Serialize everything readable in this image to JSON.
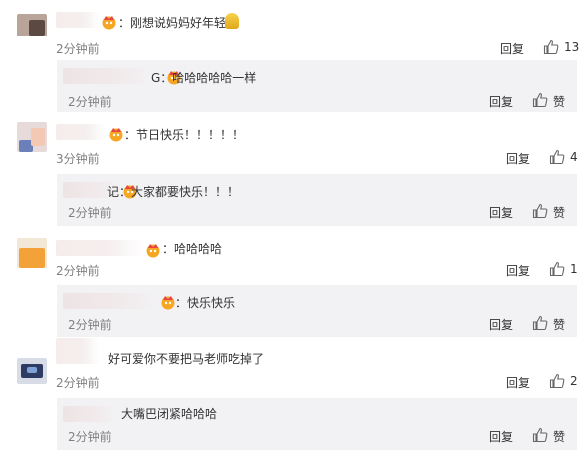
{
  "comments": [
    {
      "text": "：刚想说妈妈好年轻",
      "time": "2分钟前",
      "reply_label": "回复",
      "like_count": "13",
      "reply": {
        "text": "G：哈哈哈哈哈一样",
        "time": "2分钟前",
        "reply_label": "回复",
        "like_label": "赞"
      }
    },
    {
      "text": "：节日快乐！！！！！",
      "time": "3分钟前",
      "reply_label": "回复",
      "like_count": "4",
      "reply": {
        "text": "记：大家都要快乐！！！",
        "time": "2分钟前",
        "reply_label": "回复",
        "like_label": "赞"
      }
    },
    {
      "text": "：哈哈哈哈",
      "time": "2分钟前",
      "reply_label": "回复",
      "like_count": "1",
      "reply": {
        "text": "：快乐快乐",
        "time": "2分钟前",
        "reply_label": "回复",
        "like_label": "赞"
      }
    },
    {
      "text": "好可爱你不要把马老师吃掉了",
      "time": "2分钟前",
      "reply_label": "回复",
      "like_count": "2",
      "reply": {
        "text": "大嘴巴闭紧哈哈哈",
        "time": "2分钟前",
        "reply_label": "回复",
        "like_label": "赞"
      }
    }
  ],
  "colors": {
    "text": "#333333",
    "time": "#808080",
    "reply_bg": "#f2f2f5",
    "badge_gold": "#f5a623",
    "badge_red": "#e64545"
  },
  "icons": {
    "like": "thumb-up-icon",
    "badge": "vip-crown-icon"
  }
}
